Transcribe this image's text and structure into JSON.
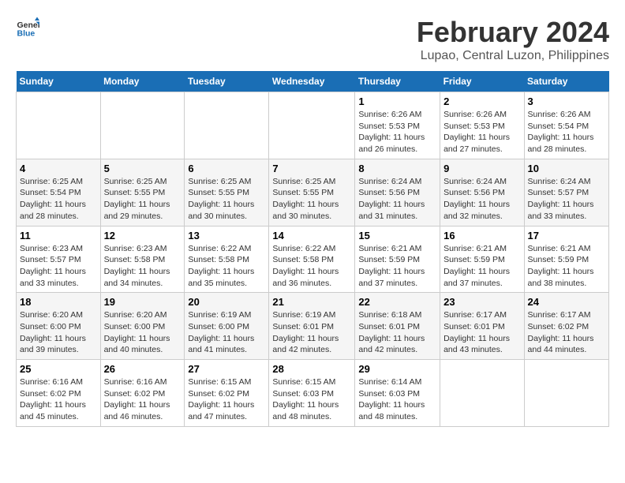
{
  "header": {
    "logo_general": "General",
    "logo_blue": "Blue",
    "title": "February 2024",
    "subtitle": "Lupao, Central Luzon, Philippines"
  },
  "days_of_week": [
    "Sunday",
    "Monday",
    "Tuesday",
    "Wednesday",
    "Thursday",
    "Friday",
    "Saturday"
  ],
  "weeks": [
    [
      {
        "day": "",
        "info": ""
      },
      {
        "day": "",
        "info": ""
      },
      {
        "day": "",
        "info": ""
      },
      {
        "day": "",
        "info": ""
      },
      {
        "day": "1",
        "info": "Sunrise: 6:26 AM\nSunset: 5:53 PM\nDaylight: 11 hours and 26 minutes."
      },
      {
        "day": "2",
        "info": "Sunrise: 6:26 AM\nSunset: 5:53 PM\nDaylight: 11 hours and 27 minutes."
      },
      {
        "day": "3",
        "info": "Sunrise: 6:26 AM\nSunset: 5:54 PM\nDaylight: 11 hours and 28 minutes."
      }
    ],
    [
      {
        "day": "4",
        "info": "Sunrise: 6:25 AM\nSunset: 5:54 PM\nDaylight: 11 hours and 28 minutes."
      },
      {
        "day": "5",
        "info": "Sunrise: 6:25 AM\nSunset: 5:55 PM\nDaylight: 11 hours and 29 minutes."
      },
      {
        "day": "6",
        "info": "Sunrise: 6:25 AM\nSunset: 5:55 PM\nDaylight: 11 hours and 30 minutes."
      },
      {
        "day": "7",
        "info": "Sunrise: 6:25 AM\nSunset: 5:55 PM\nDaylight: 11 hours and 30 minutes."
      },
      {
        "day": "8",
        "info": "Sunrise: 6:24 AM\nSunset: 5:56 PM\nDaylight: 11 hours and 31 minutes."
      },
      {
        "day": "9",
        "info": "Sunrise: 6:24 AM\nSunset: 5:56 PM\nDaylight: 11 hours and 32 minutes."
      },
      {
        "day": "10",
        "info": "Sunrise: 6:24 AM\nSunset: 5:57 PM\nDaylight: 11 hours and 33 minutes."
      }
    ],
    [
      {
        "day": "11",
        "info": "Sunrise: 6:23 AM\nSunset: 5:57 PM\nDaylight: 11 hours and 33 minutes."
      },
      {
        "day": "12",
        "info": "Sunrise: 6:23 AM\nSunset: 5:58 PM\nDaylight: 11 hours and 34 minutes."
      },
      {
        "day": "13",
        "info": "Sunrise: 6:22 AM\nSunset: 5:58 PM\nDaylight: 11 hours and 35 minutes."
      },
      {
        "day": "14",
        "info": "Sunrise: 6:22 AM\nSunset: 5:58 PM\nDaylight: 11 hours and 36 minutes."
      },
      {
        "day": "15",
        "info": "Sunrise: 6:21 AM\nSunset: 5:59 PM\nDaylight: 11 hours and 37 minutes."
      },
      {
        "day": "16",
        "info": "Sunrise: 6:21 AM\nSunset: 5:59 PM\nDaylight: 11 hours and 37 minutes."
      },
      {
        "day": "17",
        "info": "Sunrise: 6:21 AM\nSunset: 5:59 PM\nDaylight: 11 hours and 38 minutes."
      }
    ],
    [
      {
        "day": "18",
        "info": "Sunrise: 6:20 AM\nSunset: 6:00 PM\nDaylight: 11 hours and 39 minutes."
      },
      {
        "day": "19",
        "info": "Sunrise: 6:20 AM\nSunset: 6:00 PM\nDaylight: 11 hours and 40 minutes."
      },
      {
        "day": "20",
        "info": "Sunrise: 6:19 AM\nSunset: 6:00 PM\nDaylight: 11 hours and 41 minutes."
      },
      {
        "day": "21",
        "info": "Sunrise: 6:19 AM\nSunset: 6:01 PM\nDaylight: 11 hours and 42 minutes."
      },
      {
        "day": "22",
        "info": "Sunrise: 6:18 AM\nSunset: 6:01 PM\nDaylight: 11 hours and 42 minutes."
      },
      {
        "day": "23",
        "info": "Sunrise: 6:17 AM\nSunset: 6:01 PM\nDaylight: 11 hours and 43 minutes."
      },
      {
        "day": "24",
        "info": "Sunrise: 6:17 AM\nSunset: 6:02 PM\nDaylight: 11 hours and 44 minutes."
      }
    ],
    [
      {
        "day": "25",
        "info": "Sunrise: 6:16 AM\nSunset: 6:02 PM\nDaylight: 11 hours and 45 minutes."
      },
      {
        "day": "26",
        "info": "Sunrise: 6:16 AM\nSunset: 6:02 PM\nDaylight: 11 hours and 46 minutes."
      },
      {
        "day": "27",
        "info": "Sunrise: 6:15 AM\nSunset: 6:02 PM\nDaylight: 11 hours and 47 minutes."
      },
      {
        "day": "28",
        "info": "Sunrise: 6:15 AM\nSunset: 6:03 PM\nDaylight: 11 hours and 48 minutes."
      },
      {
        "day": "29",
        "info": "Sunrise: 6:14 AM\nSunset: 6:03 PM\nDaylight: 11 hours and 48 minutes."
      },
      {
        "day": "",
        "info": ""
      },
      {
        "day": "",
        "info": ""
      }
    ]
  ]
}
